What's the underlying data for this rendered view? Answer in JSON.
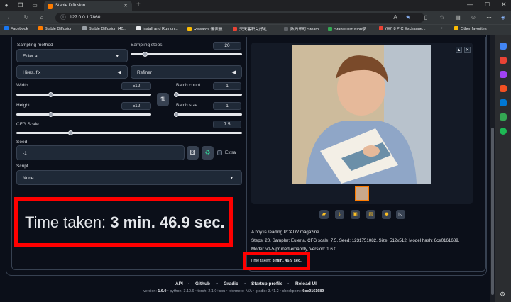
{
  "browser": {
    "tab_title": "Stable Diffusion",
    "url": "127.0.0.1:7860",
    "bookmarks": [
      "Facebook",
      "Stable Diffusion",
      "Stable Diffusion (40...",
      "Install and Run on...",
      "Rewards 儀表板",
      "天天客积兑好礼！...",
      "数码乐町 Steam",
      "Stable Diffusion學...",
      "(00) 8 PIC Exchange..."
    ],
    "other_favorites": "Other favorites"
  },
  "settings": {
    "sampling_method_label": "Sampling method",
    "sampling_method_value": "Euler a",
    "sampling_steps_label": "Sampling steps",
    "sampling_steps_value": "20",
    "hires_fix": "Hires. fix",
    "refiner": "Refiner",
    "width_label": "Width",
    "width_value": "512",
    "height_label": "Height",
    "height_value": "512",
    "batch_count_label": "Batch count",
    "batch_count_value": "1",
    "batch_size_label": "Batch size",
    "batch_size_value": "1",
    "cfg_label": "CFG Scale",
    "cfg_value": "7.5",
    "seed_label": "Seed",
    "seed_value": "-1",
    "extra_label": "Extra",
    "script_label": "Script",
    "script_value": "None",
    "slider_levels": {
      "sampling_steps": 0.13,
      "width": 0.25,
      "height": 0.25,
      "batch_count": 0.0,
      "batch_size": 0.0,
      "cfg": 0.24
    }
  },
  "big_time": {
    "prefix": "Time taken: ",
    "value": "3 min. 46.9 sec."
  },
  "output": {
    "prompt": "A boy is reading PCADV magazine",
    "params_line1": "Steps: 20, Sampler: Euler a, CFG scale: 7.5, Seed: 1231751082, Size: 512x512, Model hash: 6ce0161689,",
    "params_line2": "Model: v1-5-pruned-emaonly, Version: 1.6.0",
    "time_prefix": "Time taken: ",
    "time_value": "3 min. 46.9 sec."
  },
  "footer": {
    "links": [
      "API",
      "Github",
      "Gradio",
      "Startup profile",
      "Reload UI"
    ],
    "separator": "•",
    "versions": [
      {
        "k": "version: ",
        "v": "1.6.0"
      },
      {
        "k": "python: ",
        "v": "3.10.6"
      },
      {
        "k": "torch: ",
        "v": "2.1.0+cpu"
      },
      {
        "k": "xformers: ",
        "v": "N/A"
      },
      {
        "k": "gradio: ",
        "v": "3.41.2"
      },
      {
        "k": "checkpoint: ",
        "v": "6ce0161689"
      }
    ]
  },
  "colors": {
    "accent": "#ff7c00",
    "highlight": "#ff0000",
    "bg": "#0b0f19"
  }
}
